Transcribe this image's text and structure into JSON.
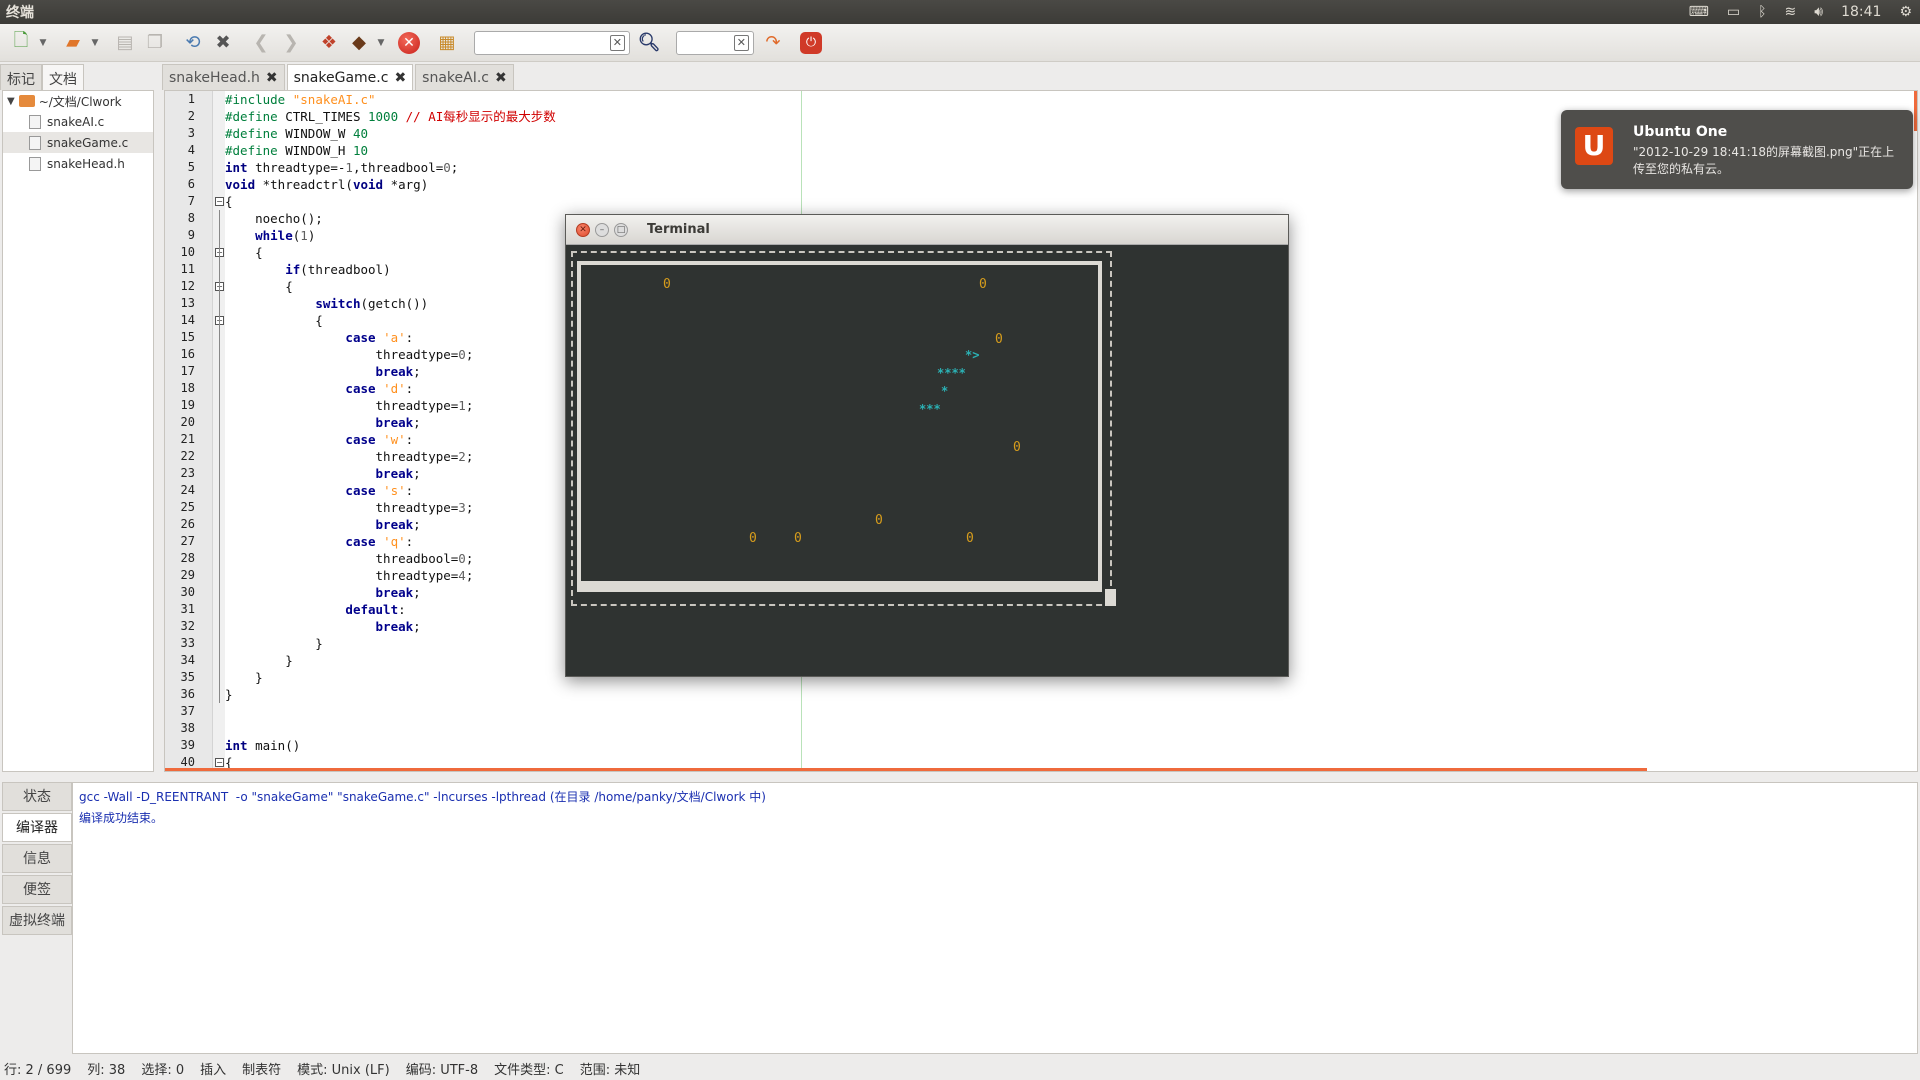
{
  "topbar": {
    "app_title": "终端",
    "clock": "18:41",
    "icons": [
      "keyboard-icon",
      "battery-icon",
      "bluetooth-icon",
      "wifi-icon",
      "volume-icon",
      "gear-icon"
    ]
  },
  "toolbar": {
    "icons": [
      "new-file-icon",
      "open-file-icon",
      "save-icon",
      "save-all-icon",
      "revert-icon",
      "close-icon",
      "back-icon",
      "forward-icon",
      "compile-icon",
      "build-icon",
      "stop-icon",
      "color-chooser-icon",
      "search-icon",
      "jump-icon",
      "quit-icon"
    ],
    "search_value": "",
    "goto_value": ""
  },
  "sidebar": {
    "tabs": [
      {
        "label": "标记"
      },
      {
        "label": "文档"
      }
    ],
    "active_tab": "文档",
    "root": "~/文档/Clwork",
    "files": [
      {
        "name": "snakeAI.c"
      },
      {
        "name": "snakeGame.c"
      },
      {
        "name": "snakeHead.h"
      }
    ],
    "selected_file": "snakeGame.c"
  },
  "editor": {
    "tabs": [
      {
        "label": "snakeHead.h"
      },
      {
        "label": "snakeGame.c"
      },
      {
        "label": "snakeAI.c"
      }
    ],
    "active_tab": "snakeGame.c",
    "line_numbers": [
      "1",
      "2",
      "3",
      "4",
      "5",
      "6",
      "7",
      "8",
      "9",
      "10",
      "11",
      "12",
      "13",
      "14",
      "15",
      "16",
      "17",
      "18",
      "19",
      "20",
      "21",
      "22",
      "23",
      "24",
      "25",
      "26",
      "27",
      "28",
      "29",
      "30",
      "31",
      "32",
      "33",
      "34",
      "35",
      "36",
      "37",
      "38",
      "39",
      "40"
    ],
    "lines": [
      "#include \"snakeAI.c\"",
      "#define CTRL_TIMES 1000 // AI每秒显示的最大步数",
      "#define WINDOW_W 40",
      "#define WINDOW_H 10",
      "int threadtype=-1,threadbool=0;",
      "void *threadctrl(void *arg)",
      "{",
      "    noecho();",
      "    while(1)",
      "    {",
      "        if(threadbool)",
      "        {",
      "            switch(getch())",
      "            {",
      "                case 'a':",
      "                    threadtype=0;",
      "                    break;",
      "                case 'd':",
      "                    threadtype=1;",
      "                    break;",
      "                case 'w':",
      "                    threadtype=2;",
      "                    break;",
      "                case 's':",
      "                    threadtype=3;",
      "                    break;",
      "                case 'q':",
      "                    threadbool=0;",
      "                    threadtype=4;",
      "                    break;",
      "                default:",
      "                    break;",
      "            }",
      "        }",
      "    }",
      "}",
      "",
      "",
      "int main()",
      "{"
    ]
  },
  "messages": {
    "tabs": [
      {
        "label": "状态"
      },
      {
        "label": "编译器"
      },
      {
        "label": "信息"
      },
      {
        "label": "便签"
      },
      {
        "label": "虚拟终端"
      }
    ],
    "active_tab": "编译器",
    "lines": [
      "gcc -Wall -D_REENTRANT  -o \"snakeGame\" \"snakeGame.c\" -lncurses -lpthread (在目录 /home/panky/文档/Clwork 中)",
      "编译成功结束。"
    ]
  },
  "statusbar": {
    "segments": [
      "行: 2 / 699",
      "列: 38",
      "选择: 0",
      "插入",
      "制表符",
      "模式: Unix (LF)",
      "编码: UTF-8",
      "文件类型: C",
      "范围: 未知"
    ]
  },
  "terminal": {
    "title": "Terminal",
    "food_char": "0",
    "snake_rows": [
      "*>",
      "****",
      "*",
      "***"
    ]
  },
  "notification": {
    "title": "Ubuntu One",
    "body": "\"2012-10-29 18:41:18的屏幕截图.png\"正在上传至您的私有云。",
    "logo_letter": "U"
  }
}
